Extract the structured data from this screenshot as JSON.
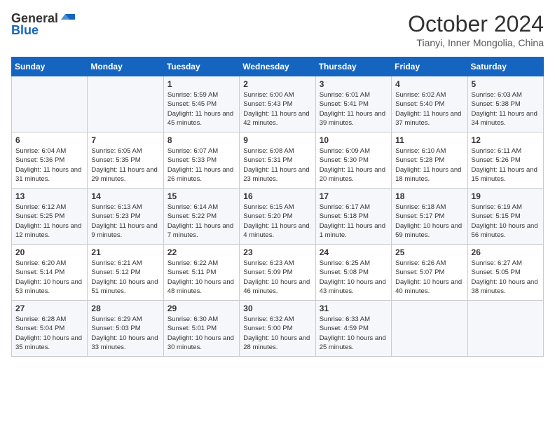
{
  "header": {
    "logo_general": "General",
    "logo_blue": "Blue",
    "title": "October 2024",
    "location": "Tianyi, Inner Mongolia, China"
  },
  "days_of_week": [
    "Sunday",
    "Monday",
    "Tuesday",
    "Wednesday",
    "Thursday",
    "Friday",
    "Saturday"
  ],
  "weeks": [
    [
      {
        "day": "",
        "text": ""
      },
      {
        "day": "",
        "text": ""
      },
      {
        "day": "1",
        "text": "Sunrise: 5:59 AM\nSunset: 5:45 PM\nDaylight: 11 hours and 45 minutes."
      },
      {
        "day": "2",
        "text": "Sunrise: 6:00 AM\nSunset: 5:43 PM\nDaylight: 11 hours and 42 minutes."
      },
      {
        "day": "3",
        "text": "Sunrise: 6:01 AM\nSunset: 5:41 PM\nDaylight: 11 hours and 39 minutes."
      },
      {
        "day": "4",
        "text": "Sunrise: 6:02 AM\nSunset: 5:40 PM\nDaylight: 11 hours and 37 minutes."
      },
      {
        "day": "5",
        "text": "Sunrise: 6:03 AM\nSunset: 5:38 PM\nDaylight: 11 hours and 34 minutes."
      }
    ],
    [
      {
        "day": "6",
        "text": "Sunrise: 6:04 AM\nSunset: 5:36 PM\nDaylight: 11 hours and 31 minutes."
      },
      {
        "day": "7",
        "text": "Sunrise: 6:05 AM\nSunset: 5:35 PM\nDaylight: 11 hours and 29 minutes."
      },
      {
        "day": "8",
        "text": "Sunrise: 6:07 AM\nSunset: 5:33 PM\nDaylight: 11 hours and 26 minutes."
      },
      {
        "day": "9",
        "text": "Sunrise: 6:08 AM\nSunset: 5:31 PM\nDaylight: 11 hours and 23 minutes."
      },
      {
        "day": "10",
        "text": "Sunrise: 6:09 AM\nSunset: 5:30 PM\nDaylight: 11 hours and 20 minutes."
      },
      {
        "day": "11",
        "text": "Sunrise: 6:10 AM\nSunset: 5:28 PM\nDaylight: 11 hours and 18 minutes."
      },
      {
        "day": "12",
        "text": "Sunrise: 6:11 AM\nSunset: 5:26 PM\nDaylight: 11 hours and 15 minutes."
      }
    ],
    [
      {
        "day": "13",
        "text": "Sunrise: 6:12 AM\nSunset: 5:25 PM\nDaylight: 11 hours and 12 minutes."
      },
      {
        "day": "14",
        "text": "Sunrise: 6:13 AM\nSunset: 5:23 PM\nDaylight: 11 hours and 9 minutes."
      },
      {
        "day": "15",
        "text": "Sunrise: 6:14 AM\nSunset: 5:22 PM\nDaylight: 11 hours and 7 minutes."
      },
      {
        "day": "16",
        "text": "Sunrise: 6:15 AM\nSunset: 5:20 PM\nDaylight: 11 hours and 4 minutes."
      },
      {
        "day": "17",
        "text": "Sunrise: 6:17 AM\nSunset: 5:18 PM\nDaylight: 11 hours and 1 minute."
      },
      {
        "day": "18",
        "text": "Sunrise: 6:18 AM\nSunset: 5:17 PM\nDaylight: 10 hours and 59 minutes."
      },
      {
        "day": "19",
        "text": "Sunrise: 6:19 AM\nSunset: 5:15 PM\nDaylight: 10 hours and 56 minutes."
      }
    ],
    [
      {
        "day": "20",
        "text": "Sunrise: 6:20 AM\nSunset: 5:14 PM\nDaylight: 10 hours and 53 minutes."
      },
      {
        "day": "21",
        "text": "Sunrise: 6:21 AM\nSunset: 5:12 PM\nDaylight: 10 hours and 51 minutes."
      },
      {
        "day": "22",
        "text": "Sunrise: 6:22 AM\nSunset: 5:11 PM\nDaylight: 10 hours and 48 minutes."
      },
      {
        "day": "23",
        "text": "Sunrise: 6:23 AM\nSunset: 5:09 PM\nDaylight: 10 hours and 46 minutes."
      },
      {
        "day": "24",
        "text": "Sunrise: 6:25 AM\nSunset: 5:08 PM\nDaylight: 10 hours and 43 minutes."
      },
      {
        "day": "25",
        "text": "Sunrise: 6:26 AM\nSunset: 5:07 PM\nDaylight: 10 hours and 40 minutes."
      },
      {
        "day": "26",
        "text": "Sunrise: 6:27 AM\nSunset: 5:05 PM\nDaylight: 10 hours and 38 minutes."
      }
    ],
    [
      {
        "day": "27",
        "text": "Sunrise: 6:28 AM\nSunset: 5:04 PM\nDaylight: 10 hours and 35 minutes."
      },
      {
        "day": "28",
        "text": "Sunrise: 6:29 AM\nSunset: 5:03 PM\nDaylight: 10 hours and 33 minutes."
      },
      {
        "day": "29",
        "text": "Sunrise: 6:30 AM\nSunset: 5:01 PM\nDaylight: 10 hours and 30 minutes."
      },
      {
        "day": "30",
        "text": "Sunrise: 6:32 AM\nSunset: 5:00 PM\nDaylight: 10 hours and 28 minutes."
      },
      {
        "day": "31",
        "text": "Sunrise: 6:33 AM\nSunset: 4:59 PM\nDaylight: 10 hours and 25 minutes."
      },
      {
        "day": "",
        "text": ""
      },
      {
        "day": "",
        "text": ""
      }
    ]
  ]
}
